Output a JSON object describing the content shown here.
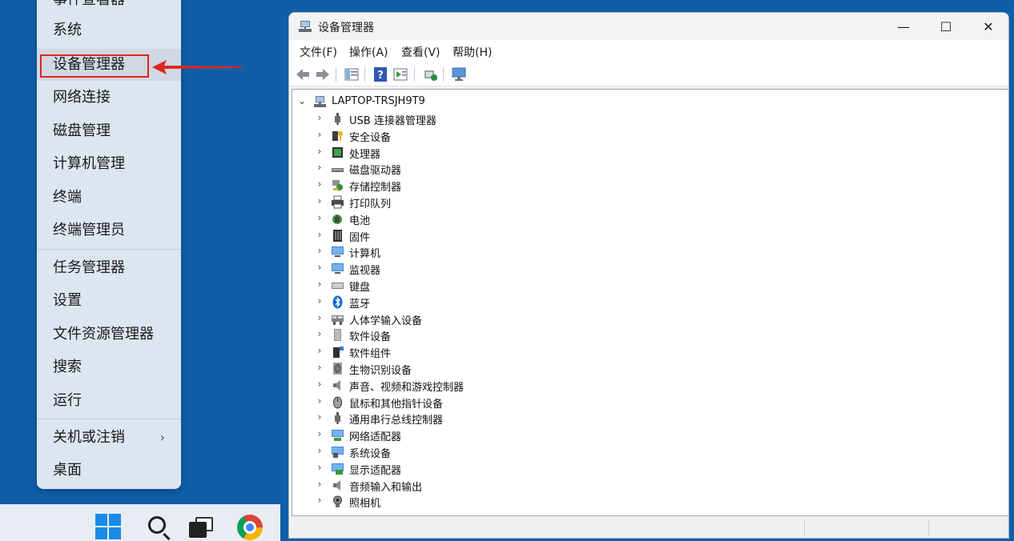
{
  "winx_menu": {
    "items": [
      {
        "label": "事件查看器"
      },
      {
        "label": "系统"
      },
      {
        "label": "设备管理器"
      },
      {
        "label": "网络连接"
      },
      {
        "label": "磁盘管理"
      },
      {
        "label": "计算机管理"
      },
      {
        "label": "终端"
      },
      {
        "label": "终端管理员"
      },
      {
        "label": "任务管理器"
      },
      {
        "label": "设置"
      },
      {
        "label": "文件资源管理器"
      },
      {
        "label": "搜索"
      },
      {
        "label": "运行"
      },
      {
        "label": "关机或注销",
        "submenu_icon": "chevron-right-icon",
        "submenu_glyph": "›"
      },
      {
        "label": "桌面"
      }
    ],
    "highlighted_item": "设备管理器",
    "highlight_color": "#e0251b"
  },
  "taskbar": {
    "icons": [
      "windows-start-icon",
      "search-icon",
      "task-view-icon",
      "chrome-icon"
    ]
  },
  "window": {
    "title": "设备管理器",
    "minimize_glyph": "—",
    "maximize_glyph": "☐",
    "close_glyph": "✕",
    "menus": [
      {
        "label": "文件(F)"
      },
      {
        "label": "操作(A)"
      },
      {
        "label": "查看(V)"
      },
      {
        "label": "帮助(H)"
      }
    ],
    "toolbar": [
      "back-icon",
      "forward-icon",
      "show-hide-console-tree-icon",
      "help-icon",
      "properties-icon",
      "scan-hardware-icon",
      "monitor-icon"
    ]
  },
  "tree": {
    "root": {
      "label": "LAPTOP-TRSJH9T9",
      "expander": "⌄"
    },
    "collapsed_glyph": "›",
    "categories": [
      {
        "label": "USB 连接器管理器",
        "icon": "usb-icon"
      },
      {
        "label": "安全设备",
        "icon": "security-key-icon"
      },
      {
        "label": "处理器",
        "icon": "processor-icon"
      },
      {
        "label": "磁盘驱动器",
        "icon": "disk-drive-icon"
      },
      {
        "label": "存储控制器",
        "icon": "storage-controller-icon"
      },
      {
        "label": "打印队列",
        "icon": "printer-icon"
      },
      {
        "label": "电池",
        "icon": "battery-icon"
      },
      {
        "label": "固件",
        "icon": "firmware-icon"
      },
      {
        "label": "计算机",
        "icon": "computer-icon"
      },
      {
        "label": "监视器",
        "icon": "monitor-icon"
      },
      {
        "label": "键盘",
        "icon": "keyboard-icon"
      },
      {
        "label": "蓝牙",
        "icon": "bluetooth-icon"
      },
      {
        "label": "人体学输入设备",
        "icon": "hid-icon"
      },
      {
        "label": "软件设备",
        "icon": "software-device-icon"
      },
      {
        "label": "软件组件",
        "icon": "software-component-icon"
      },
      {
        "label": "生物识别设备",
        "icon": "fingerprint-icon"
      },
      {
        "label": "声音、视频和游戏控制器",
        "icon": "speaker-icon"
      },
      {
        "label": "鼠标和其他指针设备",
        "icon": "mouse-icon"
      },
      {
        "label": "通用串行总线控制器",
        "icon": "usb-controller-icon"
      },
      {
        "label": "网络适配器",
        "icon": "network-adapter-icon"
      },
      {
        "label": "系统设备",
        "icon": "system-device-icon"
      },
      {
        "label": "显示适配器",
        "icon": "display-adapter-icon"
      },
      {
        "label": "音频输入和输出",
        "icon": "audio-io-icon"
      },
      {
        "label": "照相机",
        "icon": "camera-icon"
      }
    ]
  },
  "colors": {
    "desktop": "#0f5ea8",
    "menu_bg": "#dde6f0",
    "accent_red": "#e0251b"
  }
}
